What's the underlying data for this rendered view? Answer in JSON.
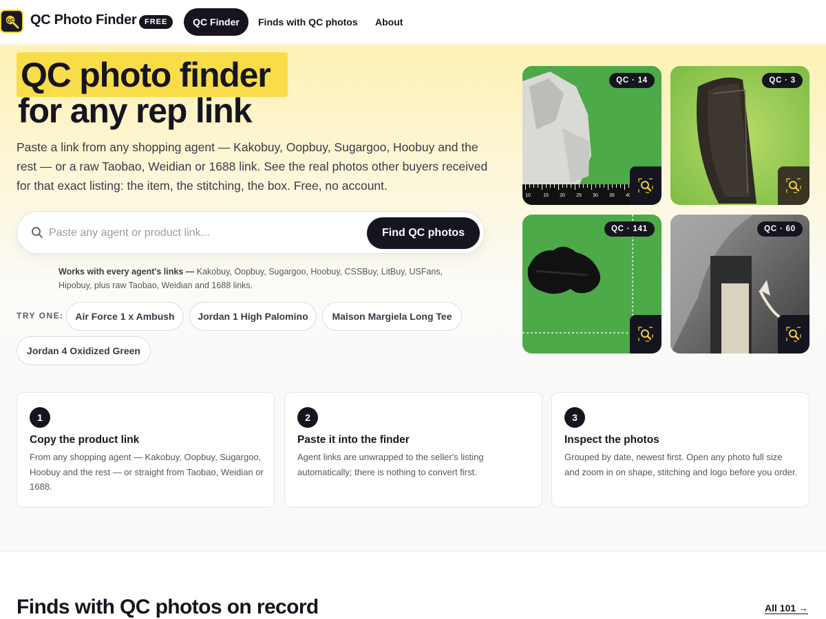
{
  "nav": {
    "brand": "QC Photo Finder",
    "badge": "FREE",
    "links": [
      {
        "label": "QC Finder",
        "active": true
      },
      {
        "label": "Finds with QC photos",
        "active": false
      },
      {
        "label": "About",
        "active": false
      }
    ],
    "logo_icon": "qc-magnifier-logo-icon"
  },
  "hero": {
    "title_line1": "QC photo finder",
    "title_line2": "for any rep link",
    "lead": "Paste a link from any shopping agent — Kakobuy, Oopbuy, Sugargoo, Hoobuy and the rest — or a raw Taobao, Weidian or 1688 link. See the real photos other buyers received for that exact listing: the item, the stitching, the box. Free, no account.",
    "search": {
      "placeholder": "Paste any agent or product link...",
      "value": "",
      "button": "Find QC photos",
      "icon": "search-icon"
    },
    "works_bold": "Works with every agent's links —",
    "works_rest": " Kakobuy, Oopbuy, Sugargoo, Hoobuy, CSSBuy, LitBuy, USFans, Hipobuy, plus raw Taobao, Weidian and 1688 links.",
    "try_label": "TRY ONE:",
    "try_chips": [
      "Air Force 1 x Ambush",
      "Jordan 1 High Palomino",
      "Maison Margiela Long Tee",
      "Jordan 4 Oxidized Green"
    ],
    "tiles": [
      {
        "badge": "QC · 14",
        "subject": "grey balaclava on green mat with ruler"
      },
      {
        "badge": "QC · 3",
        "subject": "dark leather wallet on green"
      },
      {
        "badge": "QC · 141",
        "subject": "black fuzzy item on green mat"
      },
      {
        "badge": "QC · 60",
        "subject": "grey hoodie with drawstring and tag"
      }
    ],
    "ruler_ticks": [
      "10",
      "15",
      "20",
      "25",
      "30",
      "35",
      "40"
    ]
  },
  "steps": [
    {
      "num": "1",
      "title": "Copy the product link",
      "body": "From any shopping agent — Kakobuy, Oopbuy, Sugargoo, Hoobuy and the rest — or straight from Taobao, Weidian or 1688."
    },
    {
      "num": "2",
      "title": "Paste it into the finder",
      "body": "Agent links are unwrapped to the seller's listing automatically; there is nothing to convert first."
    },
    {
      "num": "3",
      "title": "Inspect the photos",
      "body": "Grouped by date, newest first. Open any photo full size and zoom in on shape, stitching and logo before you order."
    }
  ],
  "finds": {
    "title": "Finds with QC photos on record",
    "all_link": "All 101 →"
  },
  "colors": {
    "accent": "#f9dc4a",
    "dark": "#15151f",
    "mat_green": "#4caa48"
  }
}
